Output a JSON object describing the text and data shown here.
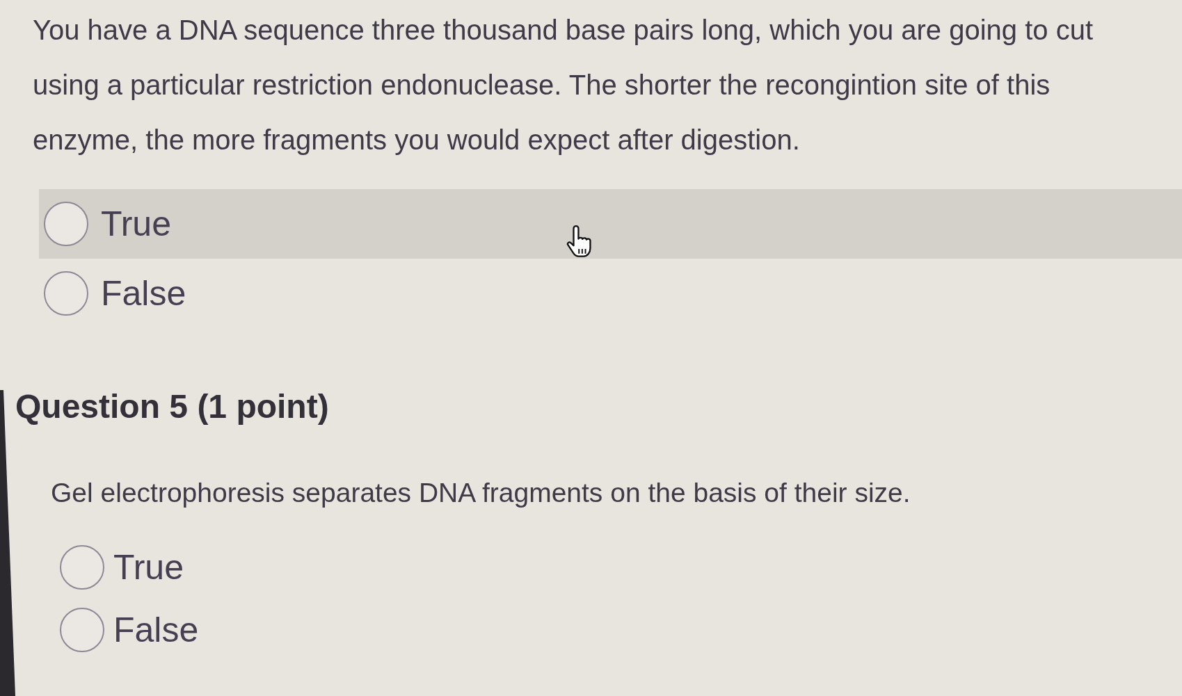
{
  "questions": [
    {
      "text": "You have a DNA sequence three thousand base pairs long, which you are going to cut using a particular restriction endonuclease. The shorter the recongintion site of this enzyme, the more fragments you would expect after digestion.",
      "options": [
        {
          "label": "True",
          "selected": false,
          "highlighted": true
        },
        {
          "label": "False",
          "selected": false,
          "highlighted": false
        }
      ]
    },
    {
      "heading": "Question 5 (1 point)",
      "text": "Gel electrophoresis separates DNA fragments on the basis of their size.",
      "options": [
        {
          "label": "True",
          "selected": false,
          "highlighted": false
        },
        {
          "label": "False",
          "selected": false,
          "highlighted": false
        }
      ]
    }
  ]
}
